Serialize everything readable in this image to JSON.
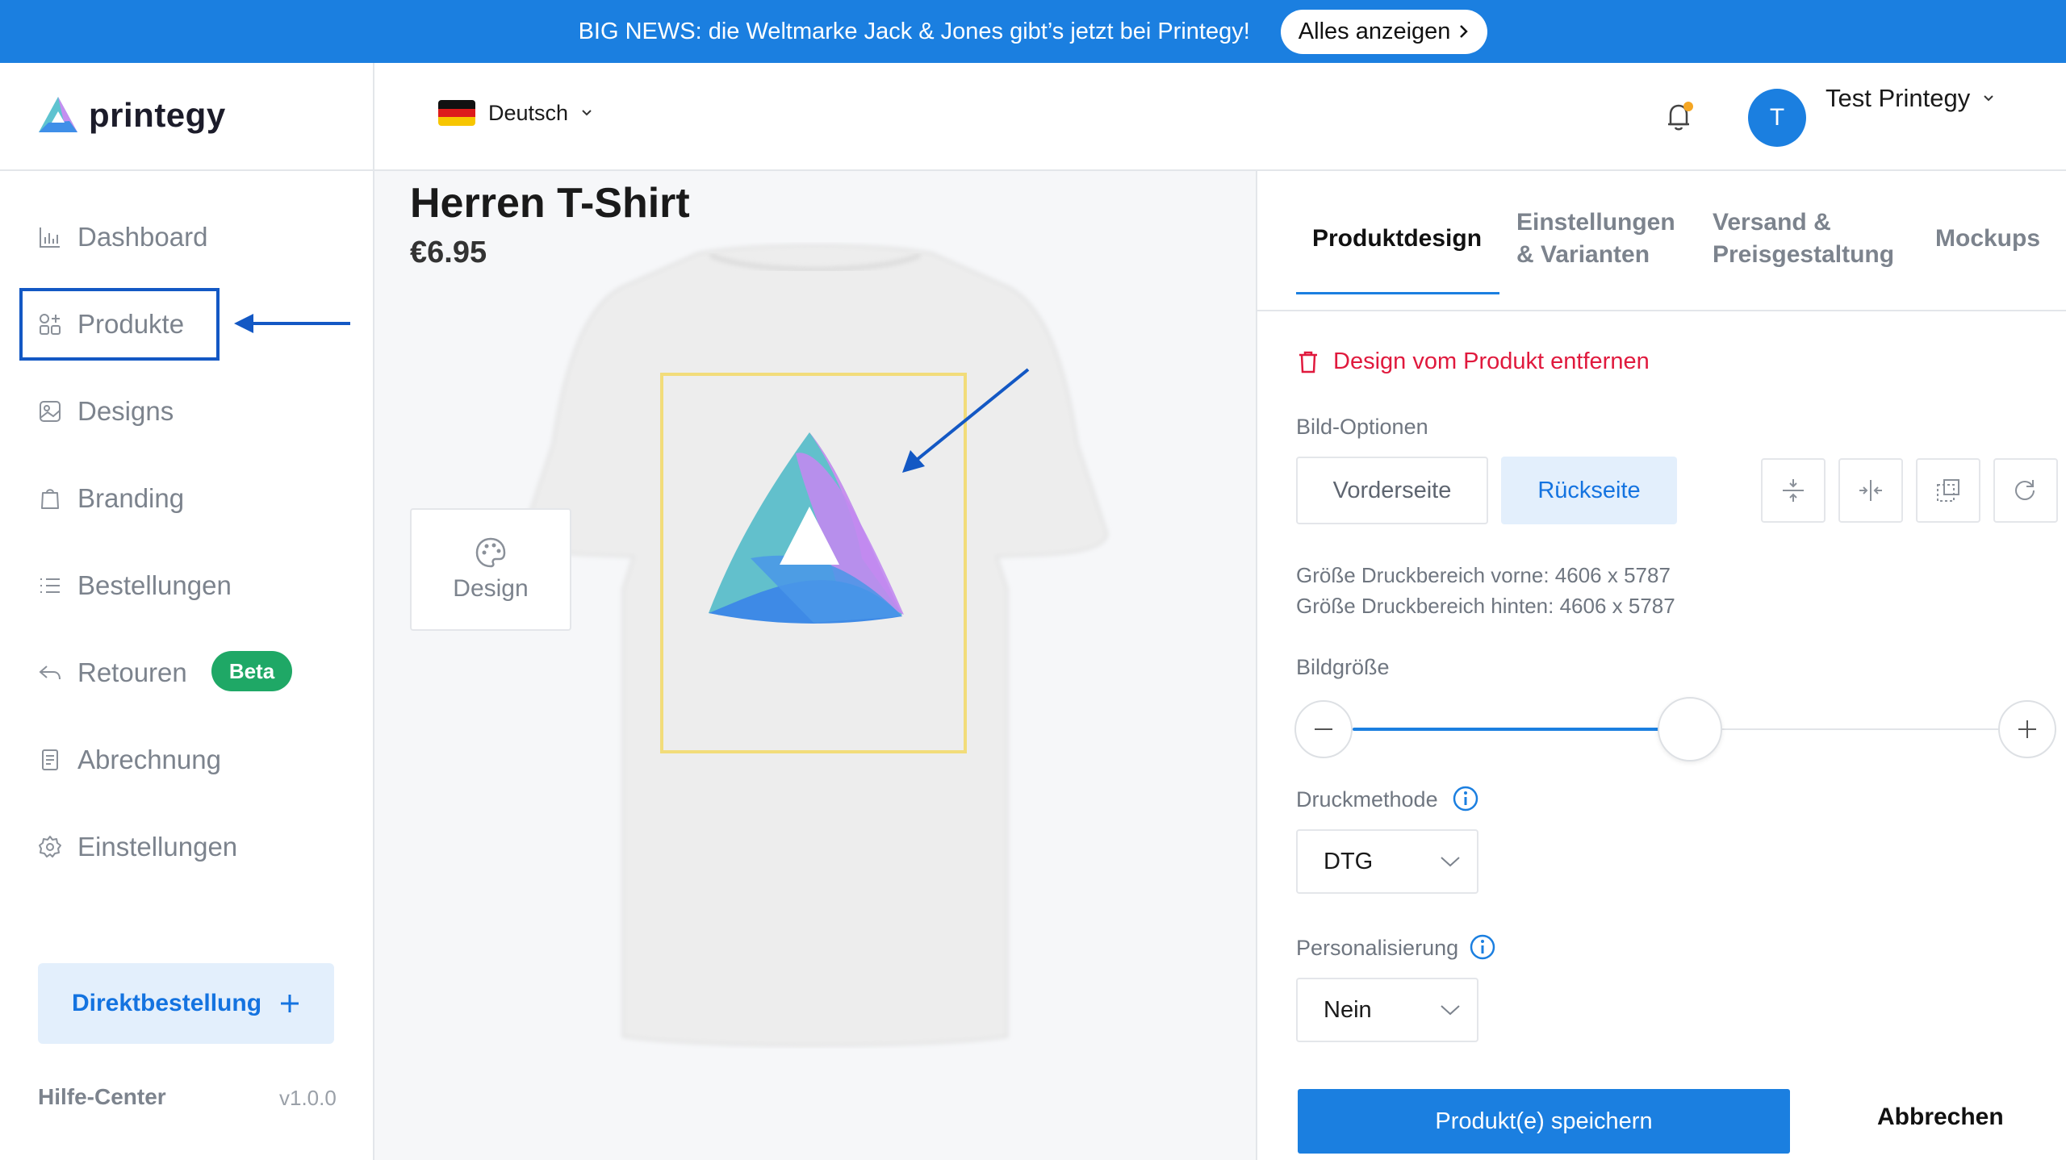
{
  "banner": {
    "text": "BIG NEWS: die Weltmarke Jack & Jones gibt’s jetzt bei Printegy!",
    "button_label": "Alles anzeigen"
  },
  "brand": {
    "name": "printegy"
  },
  "header": {
    "language": "Deutsch",
    "avatar_initial": "T",
    "user_name": "Test Printegy"
  },
  "sidebar": {
    "items": [
      {
        "label": "Dashboard",
        "icon": "bar-chart-icon"
      },
      {
        "label": "Produkte",
        "icon": "grid-shapes-icon"
      },
      {
        "label": "Designs",
        "icon": "image-icon"
      },
      {
        "label": "Branding",
        "icon": "shopping-bag-icon"
      },
      {
        "label": "Bestellungen",
        "icon": "list-icon"
      },
      {
        "label": "Retouren",
        "icon": "return-arrow-icon",
        "badge": "Beta"
      },
      {
        "label": "Abrechnung",
        "icon": "document-icon"
      },
      {
        "label": "Einstellungen",
        "icon": "gear-icon"
      }
    ],
    "direct_order_label": "Direktbestellung",
    "help_label": "Hilfe-Center",
    "version": "v1.0.0"
  },
  "product": {
    "title": "Herren T-Shirt",
    "price": "€6.95",
    "design_button_label": "Design"
  },
  "panel": {
    "tabs": [
      {
        "line1": "Produktdesign",
        "line2": ""
      },
      {
        "line1": "Einstellungen",
        "line2": "& Varianten"
      },
      {
        "line1": "Versand &",
        "line2": "Preisgestaltung"
      },
      {
        "line1": "Mockups",
        "line2": ""
      }
    ],
    "remove_label": "Design vom Produkt entfernen",
    "image_options_label": "Bild-Optionen",
    "front_label": "Vorderseite",
    "back_label": "Rückseite",
    "print_area_front": "Größe Druckbereich vorne: 4606 x 5787",
    "print_area_back": "Größe Druckbereich hinten: 4606 x 5787",
    "image_size_label": "Bildgröße",
    "image_size_level": 0.52,
    "print_method_label": "Druckmethode",
    "print_method_value": "DTG",
    "personalization_label": "Personalisierung",
    "personalization_value": "Nein",
    "save_label": "Produkt(e) speichern",
    "cancel_label": "Abbrechen"
  },
  "colors": {
    "primary": "#1b7fe0",
    "annotation": "#1358c4",
    "danger": "#e0193d",
    "badge": "#1fa866",
    "muted": "#7c838d"
  }
}
